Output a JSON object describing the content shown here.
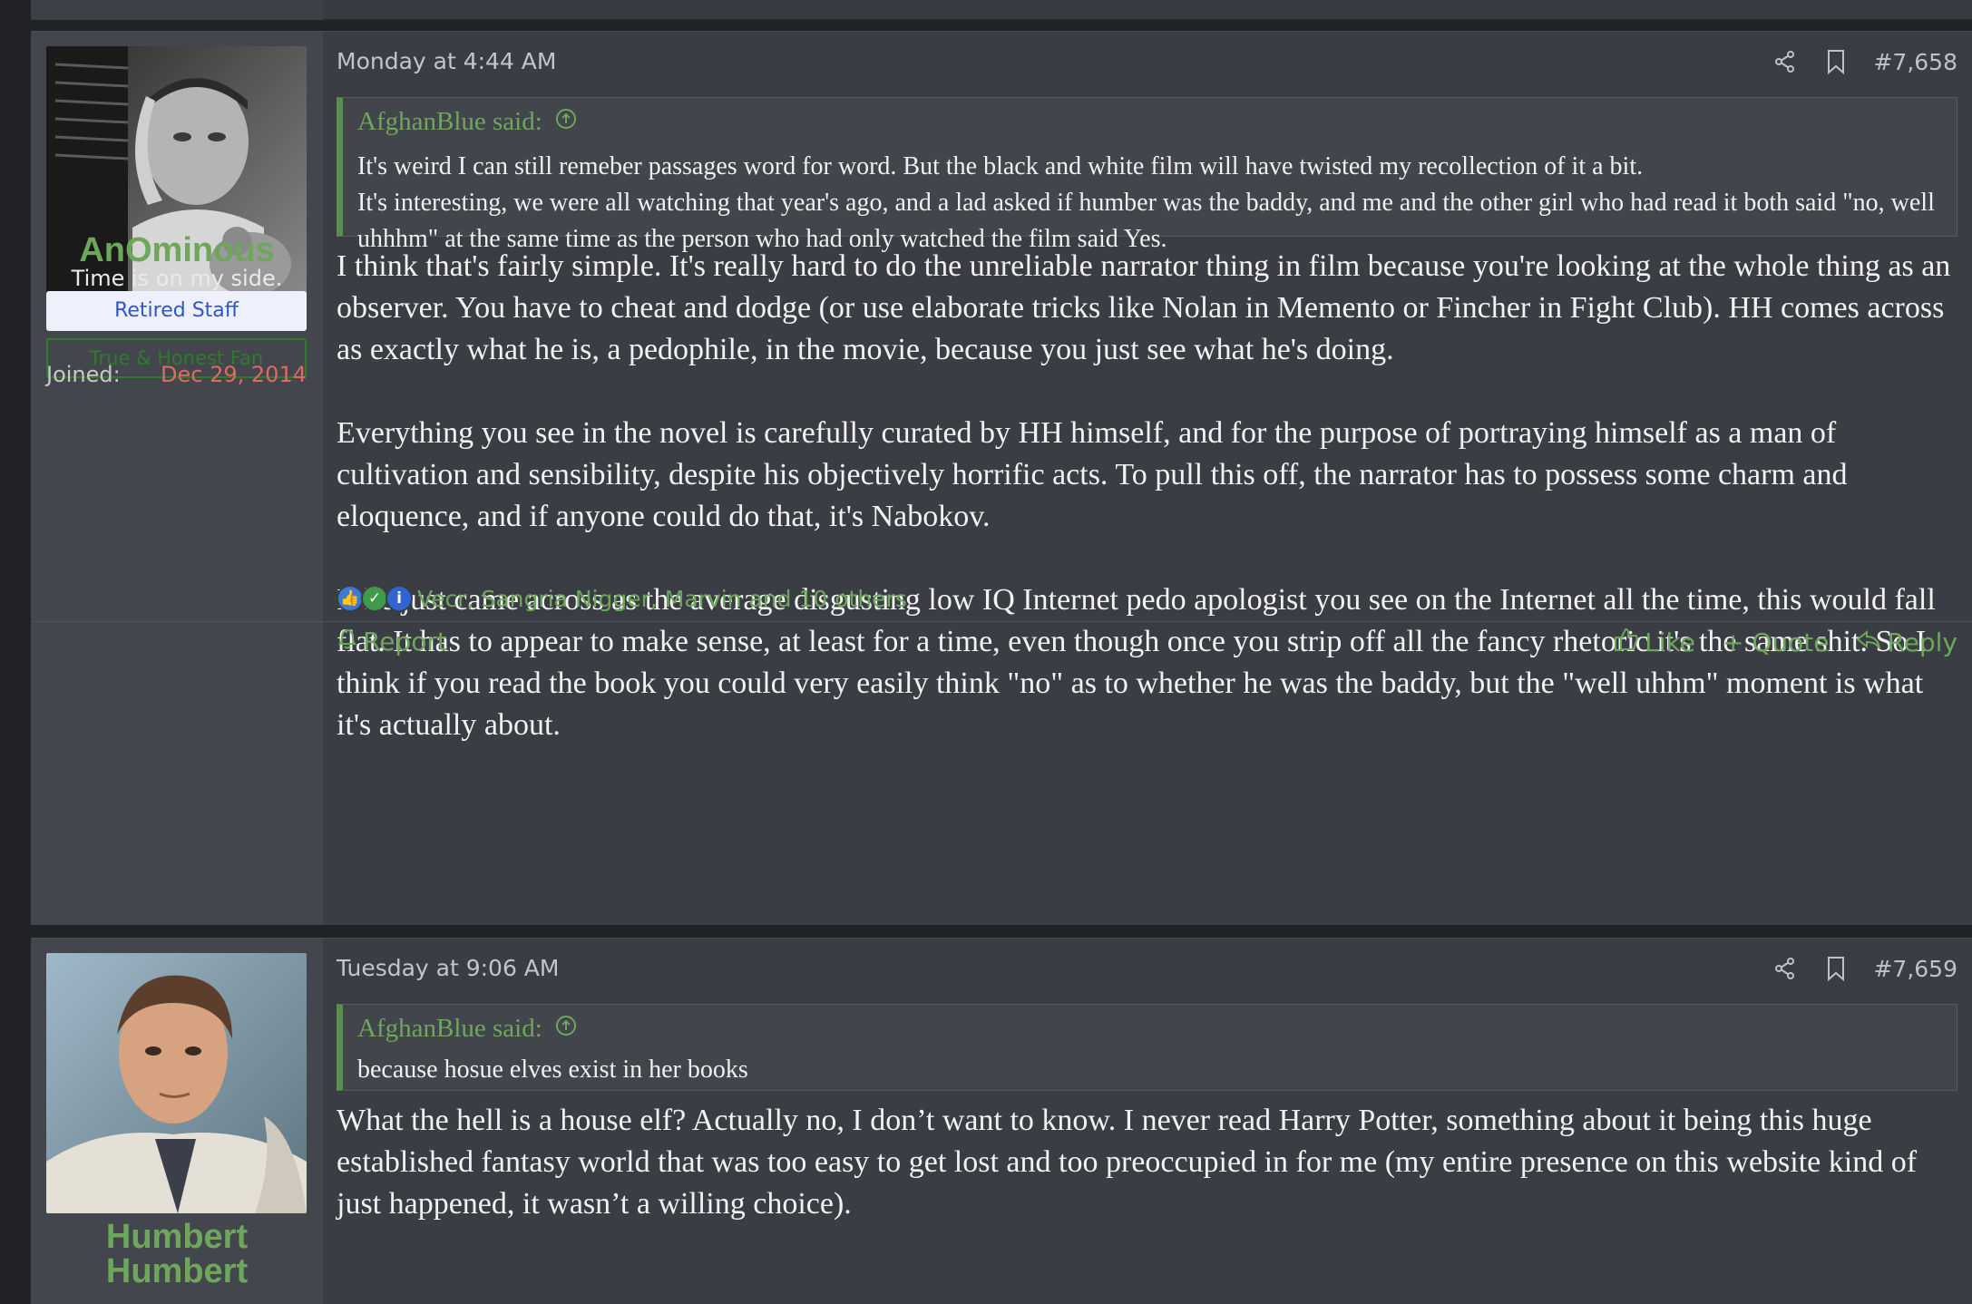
{
  "posts": [
    {
      "user": {
        "name": "AnOminous",
        "title": "Time is on my side.",
        "banners": [
          "Retired Staff",
          "True & Honest Fan"
        ],
        "joined_label": "Joined:",
        "joined_value": "Dec 29, 2014"
      },
      "date": "Monday at 4:44 AM",
      "number": "#7,658",
      "quote": {
        "author": "AfghanBlue said:",
        "lines": [
          "It's weird I can still remeber passages word for word. But the black and white film will have twisted my recollection of it a bit.",
          "It's interesting, we were all watching that year's ago, and a lad asked if humber was the baddy, and me and the other girl who had read it both said \"no, well uhhhm\" at the same time as the person who had only watched the film said Yes."
        ]
      },
      "paragraphs": [
        "I think that's fairly simple. It's really hard to do the unreliable narrator thing in film because you're looking at the whole thing as an observer. You have to cheat and dodge (or use elaborate tricks like Nolan in Memento or Fincher in Fight Club). HH comes across as exactly what he is, a pedophile, in the movie, because you just see what he's doing.",
        "Everything you see in the novel is carefully curated by HH himself, and for the purpose of portraying himself as a man of cultivation and sensibility, despite his objectively horrific acts. To pull this off, the narrator has to possess some charm and eloquence, and if anyone could do that, it's Nabokov.",
        "If he just came across as the average disgusting low IQ Internet pedo apologist you see on the Internet all the time, this would fall flat. It has to appear to make sense, at least for a time, even though once you strip off all the fancy rhetoric it's the same shit. So I think if you read the book you could very easily think \"no\" as to whether he was the baddy, but the \"well uhhm\" moment is what it's actually about."
      ],
      "reactions_text": "Vecr, Sangria Nigger, Marvin and 10 others",
      "reaction_icons": [
        "thumbs-up-icon",
        "check-icon",
        "info-icon"
      ],
      "footer": {
        "report": "Report",
        "like": "Like",
        "quote": "+ Quote",
        "reply": "Reply"
      }
    },
    {
      "user": {
        "name_line1": "Humbert",
        "name_line2": "Humbert"
      },
      "date": "Tuesday at 9:06 AM",
      "number": "#7,659",
      "quote": {
        "author": "AfghanBlue said:",
        "lines": [
          "because hosue elves exist in her books"
        ]
      },
      "paragraphs": [
        "What the hell is a house elf? Actually no, I don’t want to know. I never read Harry Potter, something about it being this huge established fantasy world that was too easy to get lost and too preoccupied in for me (my entire presence on this website kind of just happened, it wasn’t a willing choice)."
      ]
    }
  ],
  "colors": {
    "accent_green": "#6ea65c",
    "joined_red": "#e06a5f",
    "banner_blue": "#2f55c9"
  }
}
